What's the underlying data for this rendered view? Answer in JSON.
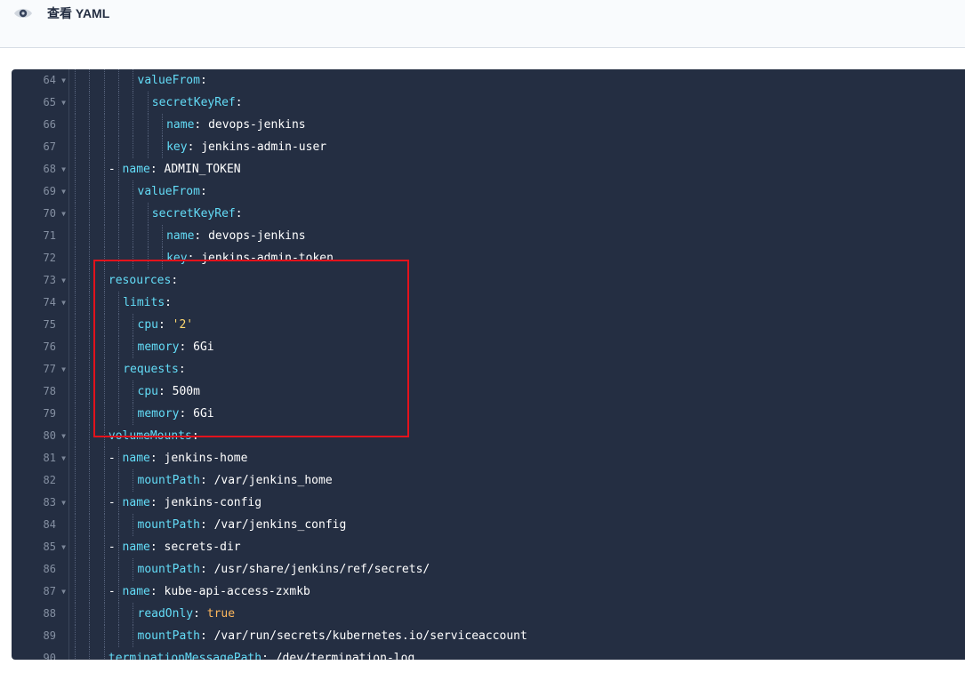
{
  "header": {
    "title": "查看 YAML",
    "icon": "eye-icon"
  },
  "editor": {
    "colors": {
      "background": "#242e42",
      "key": "#63dcf7",
      "string": "#ffd970",
      "boolean": "#ffb85c",
      "highlight_border": "#e3121c"
    },
    "lines": [
      {
        "num": "64",
        "fold": true,
        "indent": 5,
        "dash": false,
        "key": "valueFrom",
        "colon": ":",
        "value": "",
        "vtype": "plain"
      },
      {
        "num": "65",
        "fold": true,
        "indent": 6,
        "dash": false,
        "key": "secretKeyRef",
        "colon": ":",
        "value": "",
        "vtype": "plain"
      },
      {
        "num": "66",
        "fold": false,
        "indent": 7,
        "dash": false,
        "key": "name",
        "colon": ": ",
        "value": "devops-jenkins",
        "vtype": "plain"
      },
      {
        "num": "67",
        "fold": false,
        "indent": 7,
        "dash": false,
        "key": "key",
        "colon": ": ",
        "value": "jenkins-admin-user",
        "vtype": "plain"
      },
      {
        "num": "68",
        "fold": true,
        "indent": 4,
        "dash": true,
        "key": "name",
        "colon": ": ",
        "value": "ADMIN_TOKEN",
        "vtype": "plain"
      },
      {
        "num": "69",
        "fold": true,
        "indent": 5,
        "dash": false,
        "key": "valueFrom",
        "colon": ":",
        "value": "",
        "vtype": "plain"
      },
      {
        "num": "70",
        "fold": true,
        "indent": 6,
        "dash": false,
        "key": "secretKeyRef",
        "colon": ":",
        "value": "",
        "vtype": "plain"
      },
      {
        "num": "71",
        "fold": false,
        "indent": 7,
        "dash": false,
        "key": "name",
        "colon": ": ",
        "value": "devops-jenkins",
        "vtype": "plain"
      },
      {
        "num": "72",
        "fold": false,
        "indent": 7,
        "dash": false,
        "key": "key",
        "colon": ": ",
        "value": "jenkins-admin-token",
        "vtype": "plain"
      },
      {
        "num": "73",
        "fold": true,
        "indent": 3,
        "dash": false,
        "key": "resources",
        "colon": ":",
        "value": "",
        "vtype": "plain"
      },
      {
        "num": "74",
        "fold": true,
        "indent": 4,
        "dash": false,
        "key": "limits",
        "colon": ":",
        "value": "",
        "vtype": "plain"
      },
      {
        "num": "75",
        "fold": false,
        "indent": 5,
        "dash": false,
        "key": "cpu",
        "colon": ": ",
        "value": "'2'",
        "vtype": "string"
      },
      {
        "num": "76",
        "fold": false,
        "indent": 5,
        "dash": false,
        "key": "memory",
        "colon": ": ",
        "value": "6Gi",
        "vtype": "plain"
      },
      {
        "num": "77",
        "fold": true,
        "indent": 4,
        "dash": false,
        "key": "requests",
        "colon": ":",
        "value": "",
        "vtype": "plain"
      },
      {
        "num": "78",
        "fold": false,
        "indent": 5,
        "dash": false,
        "key": "cpu",
        "colon": ": ",
        "value": "500m",
        "vtype": "plain"
      },
      {
        "num": "79",
        "fold": false,
        "indent": 5,
        "dash": false,
        "key": "memory",
        "colon": ": ",
        "value": "6Gi",
        "vtype": "plain"
      },
      {
        "num": "80",
        "fold": true,
        "indent": 3,
        "dash": false,
        "key": "volumeMounts",
        "colon": ":",
        "value": "",
        "vtype": "plain"
      },
      {
        "num": "81",
        "fold": true,
        "indent": 4,
        "dash": true,
        "key": "name",
        "colon": ": ",
        "value": "jenkins-home",
        "vtype": "plain"
      },
      {
        "num": "82",
        "fold": false,
        "indent": 5,
        "dash": false,
        "key": "mountPath",
        "colon": ": ",
        "value": "/var/jenkins_home",
        "vtype": "plain"
      },
      {
        "num": "83",
        "fold": true,
        "indent": 4,
        "dash": true,
        "key": "name",
        "colon": ": ",
        "value": "jenkins-config",
        "vtype": "plain"
      },
      {
        "num": "84",
        "fold": false,
        "indent": 5,
        "dash": false,
        "key": "mountPath",
        "colon": ": ",
        "value": "/var/jenkins_config",
        "vtype": "plain"
      },
      {
        "num": "85",
        "fold": true,
        "indent": 4,
        "dash": true,
        "key": "name",
        "colon": ": ",
        "value": "secrets-dir",
        "vtype": "plain"
      },
      {
        "num": "86",
        "fold": false,
        "indent": 5,
        "dash": false,
        "key": "mountPath",
        "colon": ": ",
        "value": "/usr/share/jenkins/ref/secrets/",
        "vtype": "plain"
      },
      {
        "num": "87",
        "fold": true,
        "indent": 4,
        "dash": true,
        "key": "name",
        "colon": ": ",
        "value": "kube-api-access-zxmkb",
        "vtype": "plain"
      },
      {
        "num": "88",
        "fold": false,
        "indent": 5,
        "dash": false,
        "key": "readOnly",
        "colon": ": ",
        "value": "true",
        "vtype": "bool"
      },
      {
        "num": "89",
        "fold": false,
        "indent": 5,
        "dash": false,
        "key": "mountPath",
        "colon": ": ",
        "value": "/var/run/secrets/kubernetes.io/serviceaccount",
        "vtype": "plain"
      },
      {
        "num": "90",
        "fold": false,
        "indent": 3,
        "dash": false,
        "key": "terminationMessagePath",
        "colon": ": ",
        "value": "/dev/termination-log",
        "vtype": "plain"
      }
    ]
  }
}
